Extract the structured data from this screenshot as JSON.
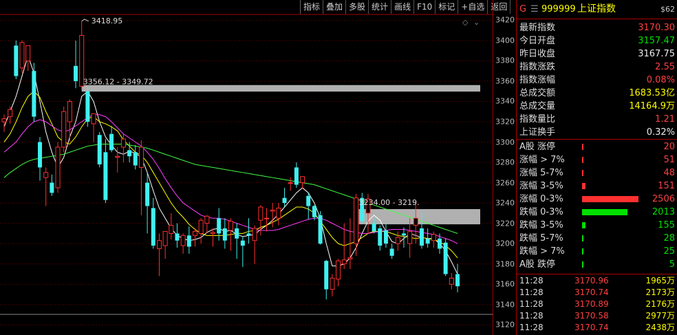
{
  "toolbar": {
    "buttons": [
      "指标",
      "叠加",
      "多股",
      "统计",
      "画线",
      "F10",
      "标记",
      "+自选",
      "返回"
    ]
  },
  "chart_data": {
    "type": "candlestick",
    "ylim": [
      3110,
      3425
    ],
    "y_ticks": [
      3120,
      3140,
      3160,
      3180,
      3200,
      3220,
      3240,
      3260,
      3280,
      3300,
      3320,
      3340,
      3360,
      3380,
      3400,
      3420
    ],
    "candles": [
      {
        "o": 3320,
        "h": 3327,
        "l": 3310,
        "c": 3323
      },
      {
        "o": 3325,
        "h": 3335,
        "l": 3318,
        "c": 3332
      },
      {
        "o": 3395,
        "h": 3400,
        "l": 3362,
        "c": 3365
      },
      {
        "o": 3373,
        "h": 3400,
        "l": 3368,
        "c": 3398
      },
      {
        "o": 3380,
        "h": 3395,
        "l": 3370,
        "c": 3395
      },
      {
        "o": 3370,
        "h": 3378,
        "l": 3320,
        "c": 3325
      },
      {
        "o": 3300,
        "h": 3305,
        "l": 3262,
        "c": 3275
      },
      {
        "o": 3265,
        "h": 3275,
        "l": 3237,
        "c": 3270
      },
      {
        "o": 3260,
        "h": 3268,
        "l": 3247,
        "c": 3250
      },
      {
        "o": 3255,
        "h": 3300,
        "l": 3250,
        "c": 3295
      },
      {
        "o": 3295,
        "h": 3335,
        "l": 3290,
        "c": 3330
      },
      {
        "o": 3320,
        "h": 3342,
        "l": 3300,
        "c": 3340
      },
      {
        "o": 3375,
        "h": 3400,
        "l": 3353,
        "c": 3360
      },
      {
        "o": 3355,
        "h": 3419,
        "l": 3352,
        "c": 3405
      },
      {
        "o": 3350,
        "h": 3354,
        "l": 3315,
        "c": 3320
      },
      {
        "o": 3318,
        "h": 3325,
        "l": 3300,
        "c": 3328
      },
      {
        "o": 3307,
        "h": 3310,
        "l": 3275,
        "c": 3278
      },
      {
        "o": 3290,
        "h": 3303,
        "l": 3240,
        "c": 3243
      },
      {
        "o": 3308,
        "h": 3316,
        "l": 3290,
        "c": 3292
      },
      {
        "o": 3285,
        "h": 3295,
        "l": 3270,
        "c": 3286
      },
      {
        "o": 3295,
        "h": 3308,
        "l": 3280,
        "c": 3303
      },
      {
        "o": 3292,
        "h": 3300,
        "l": 3280,
        "c": 3286
      },
      {
        "o": 3290,
        "h": 3297,
        "l": 3273,
        "c": 3277
      },
      {
        "o": 3275,
        "h": 3302,
        "l": 3228,
        "c": 3295
      },
      {
        "o": 3260,
        "h": 3270,
        "l": 3210,
        "c": 3237
      },
      {
        "o": 3235,
        "h": 3245,
        "l": 3195,
        "c": 3198
      },
      {
        "o": 3195,
        "h": 3210,
        "l": 3168,
        "c": 3203
      },
      {
        "o": 3198,
        "h": 3210,
        "l": 3185,
        "c": 3212
      },
      {
        "o": 3210,
        "h": 3230,
        "l": 3204,
        "c": 3218
      },
      {
        "o": 3210,
        "h": 3220,
        "l": 3196,
        "c": 3203
      },
      {
        "o": 3198,
        "h": 3210,
        "l": 3190,
        "c": 3208
      },
      {
        "o": 3208,
        "h": 3217,
        "l": 3190,
        "c": 3197
      },
      {
        "o": 3208,
        "h": 3215,
        "l": 3197,
        "c": 3212
      },
      {
        "o": 3210,
        "h": 3225,
        "l": 3200,
        "c": 3223
      },
      {
        "o": 3220,
        "h": 3228,
        "l": 3210,
        "c": 3227
      },
      {
        "o": 3210,
        "h": 3215,
        "l": 3197,
        "c": 3211
      },
      {
        "o": 3225,
        "h": 3235,
        "l": 3203,
        "c": 3210
      },
      {
        "o": 3215,
        "h": 3225,
        "l": 3195,
        "c": 3203
      },
      {
        "o": 3213,
        "h": 3225,
        "l": 3193,
        "c": 3222
      },
      {
        "o": 3215,
        "h": 3220,
        "l": 3185,
        "c": 3205
      },
      {
        "o": 3203,
        "h": 3207,
        "l": 3177,
        "c": 3198
      },
      {
        "o": 3210,
        "h": 3225,
        "l": 3200,
        "c": 3208
      },
      {
        "o": 3203,
        "h": 3218,
        "l": 3180,
        "c": 3215
      },
      {
        "o": 3223,
        "h": 3238,
        "l": 3208,
        "c": 3236
      },
      {
        "o": 3225,
        "h": 3235,
        "l": 3212,
        "c": 3225
      },
      {
        "o": 3232,
        "h": 3240,
        "l": 3216,
        "c": 3233
      },
      {
        "o": 3225,
        "h": 3240,
        "l": 3218,
        "c": 3235
      },
      {
        "o": 3245,
        "h": 3255,
        "l": 3236,
        "c": 3240
      },
      {
        "o": 3260,
        "h": 3265,
        "l": 3252,
        "c": 3260
      },
      {
        "o": 3275,
        "h": 3280,
        "l": 3255,
        "c": 3258
      },
      {
        "o": 3260,
        "h": 3265,
        "l": 3254,
        "c": 3266
      },
      {
        "o": 3247,
        "h": 3250,
        "l": 3224,
        "c": 3237
      },
      {
        "o": 3237,
        "h": 3238,
        "l": 3223,
        "c": 3226
      },
      {
        "o": 3228,
        "h": 3232,
        "l": 3199,
        "c": 3200
      },
      {
        "o": 3183,
        "h": 3184,
        "l": 3145,
        "c": 3155
      },
      {
        "o": 3155,
        "h": 3170,
        "l": 3148,
        "c": 3166
      },
      {
        "o": 3165,
        "h": 3185,
        "l": 3158,
        "c": 3183
      },
      {
        "o": 3180,
        "h": 3220,
        "l": 3175,
        "c": 3184
      },
      {
        "o": 3185,
        "h": 3225,
        "l": 3175,
        "c": 3186
      },
      {
        "o": 3200,
        "h": 3249,
        "l": 3188,
        "c": 3245
      },
      {
        "o": 3245,
        "h": 3250,
        "l": 3220,
        "c": 3222
      },
      {
        "o": 3230,
        "h": 3249,
        "l": 3210,
        "c": 3244
      },
      {
        "o": 3220,
        "h": 3225,
        "l": 3210,
        "c": 3212
      },
      {
        "o": 3215,
        "h": 3218,
        "l": 3193,
        "c": 3198
      },
      {
        "o": 3213,
        "h": 3220,
        "l": 3196,
        "c": 3200
      },
      {
        "o": 3195,
        "h": 3200,
        "l": 3185,
        "c": 3188
      },
      {
        "o": 3200,
        "h": 3212,
        "l": 3193,
        "c": 3206
      },
      {
        "o": 3210,
        "h": 3216,
        "l": 3196,
        "c": 3208
      },
      {
        "o": 3200,
        "h": 3225,
        "l": 3186,
        "c": 3212
      },
      {
        "o": 3218,
        "h": 3240,
        "l": 3200,
        "c": 3225
      },
      {
        "o": 3215,
        "h": 3230,
        "l": 3195,
        "c": 3198
      },
      {
        "o": 3205,
        "h": 3215,
        "l": 3196,
        "c": 3200
      },
      {
        "o": 3203,
        "h": 3212,
        "l": 3196,
        "c": 3209
      },
      {
        "o": 3205,
        "h": 3210,
        "l": 3190,
        "c": 3195
      },
      {
        "o": 3201,
        "h": 3205,
        "l": 3168,
        "c": 3170
      },
      {
        "o": 3160,
        "h": 3171,
        "l": 3155,
        "c": 3166
      },
      {
        "o": 3170,
        "h": 3180,
        "l": 3152,
        "c": 3158
      }
    ],
    "ma_lines": [
      {
        "name": "MA5",
        "color": "#ffffff",
        "values": [
          3315,
          3330,
          3345,
          3365,
          3385,
          3368,
          3340,
          3310,
          3290,
          3275,
          3285,
          3305,
          3320,
          3345,
          3350,
          3340,
          3320,
          3305,
          3297,
          3290,
          3288,
          3291,
          3289,
          3285,
          3270,
          3252,
          3235,
          3225,
          3215,
          3208,
          3205,
          3203,
          3204,
          3206,
          3211,
          3214,
          3215,
          3212,
          3213,
          3209,
          3207,
          3208,
          3209,
          3214,
          3218,
          3223,
          3229,
          3236,
          3243,
          3250,
          3255,
          3250,
          3240,
          3225,
          3200,
          3178,
          3178,
          3180,
          3186,
          3196,
          3210,
          3222,
          3228,
          3223,
          3212,
          3202,
          3200,
          3205,
          3210,
          3208,
          3206,
          3205,
          3205,
          3200,
          3193,
          3182,
          3170
        ]
      },
      {
        "name": "MA10",
        "color": "#ffff00",
        "values": [
          3300,
          3308,
          3320,
          3334,
          3345,
          3350,
          3344,
          3330,
          3318,
          3305,
          3300,
          3298,
          3305,
          3315,
          3323,
          3325,
          3320,
          3318,
          3315,
          3311,
          3302,
          3296,
          3290,
          3287,
          3280,
          3270,
          3260,
          3250,
          3240,
          3232,
          3226,
          3219,
          3214,
          3210,
          3208,
          3208,
          3208,
          3208,
          3209,
          3210,
          3210,
          3212,
          3213,
          3216,
          3218,
          3221,
          3224,
          3228,
          3232,
          3236,
          3236,
          3234,
          3230,
          3222,
          3214,
          3206,
          3200,
          3198,
          3200,
          3202,
          3206,
          3210,
          3212,
          3212,
          3212,
          3210,
          3208,
          3207,
          3206,
          3205,
          3206,
          3205,
          3204,
          3202,
          3198,
          3193,
          3186
        ]
      },
      {
        "name": "MA20",
        "color": "#ff40ff",
        "values": [
          3290,
          3295,
          3300,
          3308,
          3315,
          3320,
          3322,
          3320,
          3316,
          3312,
          3310,
          3312,
          3316,
          3320,
          3324,
          3327,
          3327,
          3325,
          3320,
          3314,
          3308,
          3304,
          3300,
          3296,
          3290,
          3283,
          3274,
          3264,
          3255,
          3247,
          3240,
          3236,
          3232,
          3228,
          3226,
          3225,
          3225,
          3224,
          3222,
          3220,
          3218,
          3216,
          3214,
          3213,
          3213,
          3213,
          3214,
          3216,
          3218,
          3220,
          3222,
          3224,
          3225,
          3225,
          3223,
          3220,
          3217,
          3214,
          3212,
          3211,
          3210,
          3210,
          3211,
          3212,
          3213,
          3214,
          3214,
          3214,
          3213,
          3212,
          3211,
          3210,
          3209,
          3207,
          3205,
          3203,
          3200
        ]
      },
      {
        "name": "MA60",
        "color": "#40ff40",
        "values": [
          3265,
          3270,
          3274,
          3278,
          3281,
          3283,
          3284,
          3285,
          3286,
          3287,
          3288,
          3290,
          3292,
          3294,
          3296,
          3297,
          3298,
          3298,
          3298,
          3298,
          3298,
          3297,
          3296,
          3295,
          3294,
          3292,
          3290,
          3288,
          3286,
          3284,
          3282,
          3280,
          3278,
          3277,
          3276,
          3275,
          3274,
          3273,
          3272,
          3271,
          3270,
          3269,
          3268,
          3267,
          3266,
          3265,
          3264,
          3263,
          3262,
          3261,
          3260,
          3259,
          3258,
          3256,
          3254,
          3252,
          3250,
          3248,
          3246,
          3244,
          3242,
          3240,
          3238,
          3236,
          3234,
          3232,
          3230,
          3228,
          3226,
          3224,
          3222,
          3220,
          3218,
          3216,
          3214,
          3212,
          3210
        ]
      }
    ],
    "annotations": {
      "high_label": "3418.95",
      "gap1_label": "3356.12 - 3349.72",
      "gap1_range": [
        3349.72,
        3356.12
      ],
      "gap2_label": "3234.00 - 3219.",
      "gap2_range": [
        3219,
        3234
      ]
    }
  },
  "quote": {
    "title_prefix": "G",
    "menu_icon": "menu-lines-icon",
    "code": "999999",
    "name": "上证指数",
    "tag": "$62",
    "rows": [
      {
        "label": "最新指数",
        "value": "3170.30",
        "color": "red"
      },
      {
        "label": "今日开盘",
        "value": "3157.47",
        "color": "green"
      },
      {
        "label": "昨日收盘",
        "value": "3167.75",
        "color": "white"
      },
      {
        "label": "指数涨跌",
        "value": "2.55",
        "color": "red"
      },
      {
        "label": "指数涨幅",
        "value": "0.08%",
        "color": "red"
      },
      {
        "label": "总成交额",
        "value": "1683.53亿",
        "color": "yellow"
      },
      {
        "label": "总成交量",
        "value": "14164.9万",
        "color": "yellow"
      },
      {
        "label": "指数量比",
        "value": "1.21",
        "color": "red"
      },
      {
        "label": "上证换手",
        "value": "0.32%",
        "color": "white"
      }
    ],
    "breadth": [
      {
        "label": "A股 涨停",
        "value": "20",
        "color": "red",
        "bar": 0.01
      },
      {
        "label": "涨幅 > 7%",
        "value": "51",
        "color": "red",
        "bar": 0.01
      },
      {
        "label": "涨幅 5-7%",
        "value": "48",
        "color": "red",
        "bar": 0.01
      },
      {
        "label": "涨幅 3-5%",
        "value": "151",
        "color": "red",
        "bar": 0.06
      },
      {
        "label": "涨幅 0-3%",
        "value": "2506",
        "color": "red",
        "bar": 1.0
      },
      {
        "label": "跌幅 0-3%",
        "value": "2013",
        "color": "green",
        "bar": 0.8
      },
      {
        "label": "跌幅 3-5%",
        "value": "155",
        "color": "green",
        "bar": 0.06
      },
      {
        "label": "跌幅 5-7%",
        "value": "28",
        "color": "green",
        "bar": 0.01
      },
      {
        "label": "跌幅 > 7%",
        "value": "25",
        "color": "green",
        "bar": 0.01
      },
      {
        "label": "A股 跌停",
        "value": "5",
        "color": "green",
        "bar": 0.01
      }
    ],
    "ticks": [
      {
        "time": "11:28",
        "price": "3170.96",
        "vol": "1965万"
      },
      {
        "time": "11:28",
        "price": "3170.74",
        "vol": "2173万"
      },
      {
        "time": "11:28",
        "price": "3170.89",
        "vol": "2176万"
      },
      {
        "time": "11:28",
        "price": "3170.58",
        "vol": "2977万"
      },
      {
        "time": "11:28",
        "price": "3170.74",
        "vol": "2438万"
      }
    ]
  }
}
